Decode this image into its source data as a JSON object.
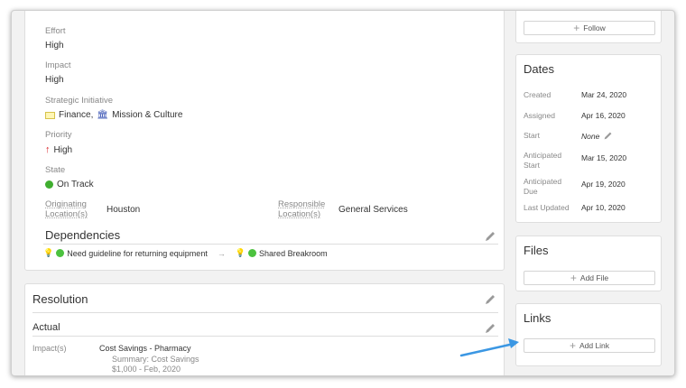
{
  "fields": {
    "effort": {
      "label": "Effort",
      "value": "High"
    },
    "impact": {
      "label": "Impact",
      "value": "High"
    },
    "strategic": {
      "label": "Strategic Initiative",
      "item1": "Finance,",
      "item2": "Mission & Culture"
    },
    "priority": {
      "label": "Priority",
      "value": "High"
    },
    "state": {
      "label": "State",
      "value": "On Track"
    },
    "originating": {
      "label": "Originating Location(s)",
      "value": "Houston"
    },
    "responsible": {
      "label": "Responsible Location(s)",
      "value": "General Services"
    }
  },
  "dependencies": {
    "title": "Dependencies",
    "from": "Need guideline for returning equipment",
    "to": "Shared Breakroom"
  },
  "resolution": {
    "title": "Resolution",
    "actual": "Actual",
    "impacts_label": "Impact(s)",
    "impact_title": "Cost Savings - Pharmacy",
    "summary": "Summary: Cost Savings",
    "amount": "$1,000 - Feb, 2020"
  },
  "follow": {
    "label": "Follow"
  },
  "dates": {
    "title": "Dates",
    "rows": [
      {
        "label": "Created",
        "value": "Mar 24, 2020"
      },
      {
        "label": "Assigned",
        "value": "Apr 16, 2020"
      },
      {
        "label": "Start",
        "value": "None"
      },
      {
        "label": "Anticipated Start",
        "value": "Mar 15, 2020"
      },
      {
        "label": "Anticipated Due",
        "value": "Apr 19, 2020"
      },
      {
        "label": "Last Updated",
        "value": "Apr 10, 2020"
      }
    ]
  },
  "files": {
    "title": "Files",
    "button": "Add File"
  },
  "links": {
    "title": "Links",
    "button": "Add Link"
  },
  "colors": {
    "accent_arrow": "#3b97e3",
    "priority_red": "#d9262b",
    "status_green": "#4cc23f"
  }
}
